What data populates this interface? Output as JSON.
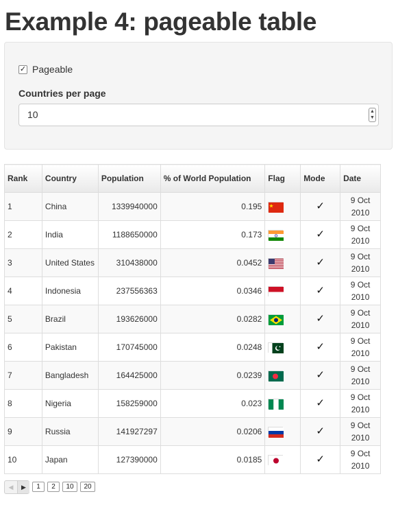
{
  "title": "Example 4: pageable table",
  "controls": {
    "pageable_label": "Pageable",
    "pageable_checked": true,
    "per_page_label": "Countries per page",
    "per_page_value": "10"
  },
  "table": {
    "headers": {
      "rank": "Rank",
      "country": "Country",
      "population": "Population",
      "pct": "% of World Population",
      "flag": "Flag",
      "mode": "Mode",
      "date": "Date"
    },
    "rows": [
      {
        "rank": "1",
        "country": "China",
        "population": "1339940000",
        "pct": "0.195",
        "flag": "china",
        "mode": "✓",
        "date": "9 Oct 2010"
      },
      {
        "rank": "2",
        "country": "India",
        "population": "1188650000",
        "pct": "0.173",
        "flag": "india",
        "mode": "✓",
        "date": "9 Oct 2010"
      },
      {
        "rank": "3",
        "country": "United States",
        "population": "310438000",
        "pct": "0.0452",
        "flag": "usa",
        "mode": "✓",
        "date": "9 Oct 2010"
      },
      {
        "rank": "4",
        "country": "Indonesia",
        "population": "237556363",
        "pct": "0.0346",
        "flag": "indonesia",
        "mode": "✓",
        "date": "9 Oct 2010"
      },
      {
        "rank": "5",
        "country": "Brazil",
        "population": "193626000",
        "pct": "0.0282",
        "flag": "brazil",
        "mode": "✓",
        "date": "9 Oct 2010"
      },
      {
        "rank": "6",
        "country": "Pakistan",
        "population": "170745000",
        "pct": "0.0248",
        "flag": "pakistan",
        "mode": "✓",
        "date": "9 Oct 2010"
      },
      {
        "rank": "7",
        "country": "Bangladesh",
        "population": "164425000",
        "pct": "0.0239",
        "flag": "bangladesh",
        "mode": "✓",
        "date": "9 Oct 2010"
      },
      {
        "rank": "8",
        "country": "Nigeria",
        "population": "158259000",
        "pct": "0.023",
        "flag": "nigeria",
        "mode": "✓",
        "date": "9 Oct 2010"
      },
      {
        "rank": "9",
        "country": "Russia",
        "population": "141927297",
        "pct": "0.0206",
        "flag": "russia",
        "mode": "✓",
        "date": "9 Oct 2010"
      },
      {
        "rank": "10",
        "country": "Japan",
        "population": "127390000",
        "pct": "0.0185",
        "flag": "japan",
        "mode": "✓",
        "date": "9 Oct 2010"
      }
    ]
  },
  "pager": {
    "prev_icon": "◀",
    "next_icon": "▶",
    "page_sizes": [
      "1",
      "2",
      "10",
      "20"
    ]
  }
}
